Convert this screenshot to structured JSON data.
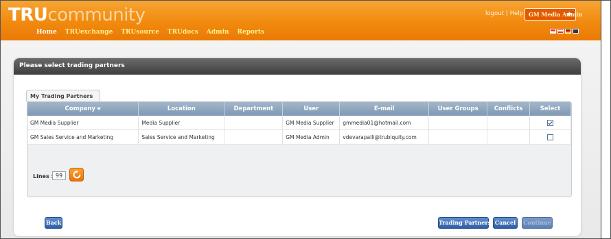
{
  "header": {
    "logo_tru": "TRU",
    "logo_community": "community",
    "nav": [
      "Home",
      "TRUexchange",
      "TRUsource",
      "TRUdocs",
      "Admin",
      "Reports"
    ],
    "logout": "logout",
    "separator": "|",
    "help": "Help",
    "user_menu": "GM Media Admin"
  },
  "panel": {
    "title": "Please select trading partners",
    "tab": "My Trading Partners"
  },
  "table": {
    "columns": [
      "Company",
      "Location",
      "Department",
      "User",
      "E-mail",
      "User Groups",
      "Conflicts",
      "Select"
    ],
    "rows": [
      {
        "company": "GM Media Supplier",
        "location": "Media Supplier",
        "department": "",
        "user": "GM Media Supplier",
        "email": "gmmedia01@hotmail.com",
        "groups": "",
        "conflicts": "",
        "selected": true
      },
      {
        "company": "GM Sales Service and Marketing",
        "location": "Sales Service and Marketing",
        "department": "",
        "user": "GM Media Admin",
        "email": "vdevarapalli@trubiquity.com",
        "groups": "",
        "conflicts": "",
        "selected": false
      }
    ]
  },
  "lines": {
    "label": "Lines :",
    "value": "99"
  },
  "buttons": {
    "back": "Back",
    "trading_partners": "Trading Partners",
    "cancel": "Cancel",
    "continue": "Continue"
  },
  "colors": {
    "header_orange": "#f18a0f",
    "button_blue": "#2f5ea5",
    "grid_header": "#8fa6be"
  }
}
